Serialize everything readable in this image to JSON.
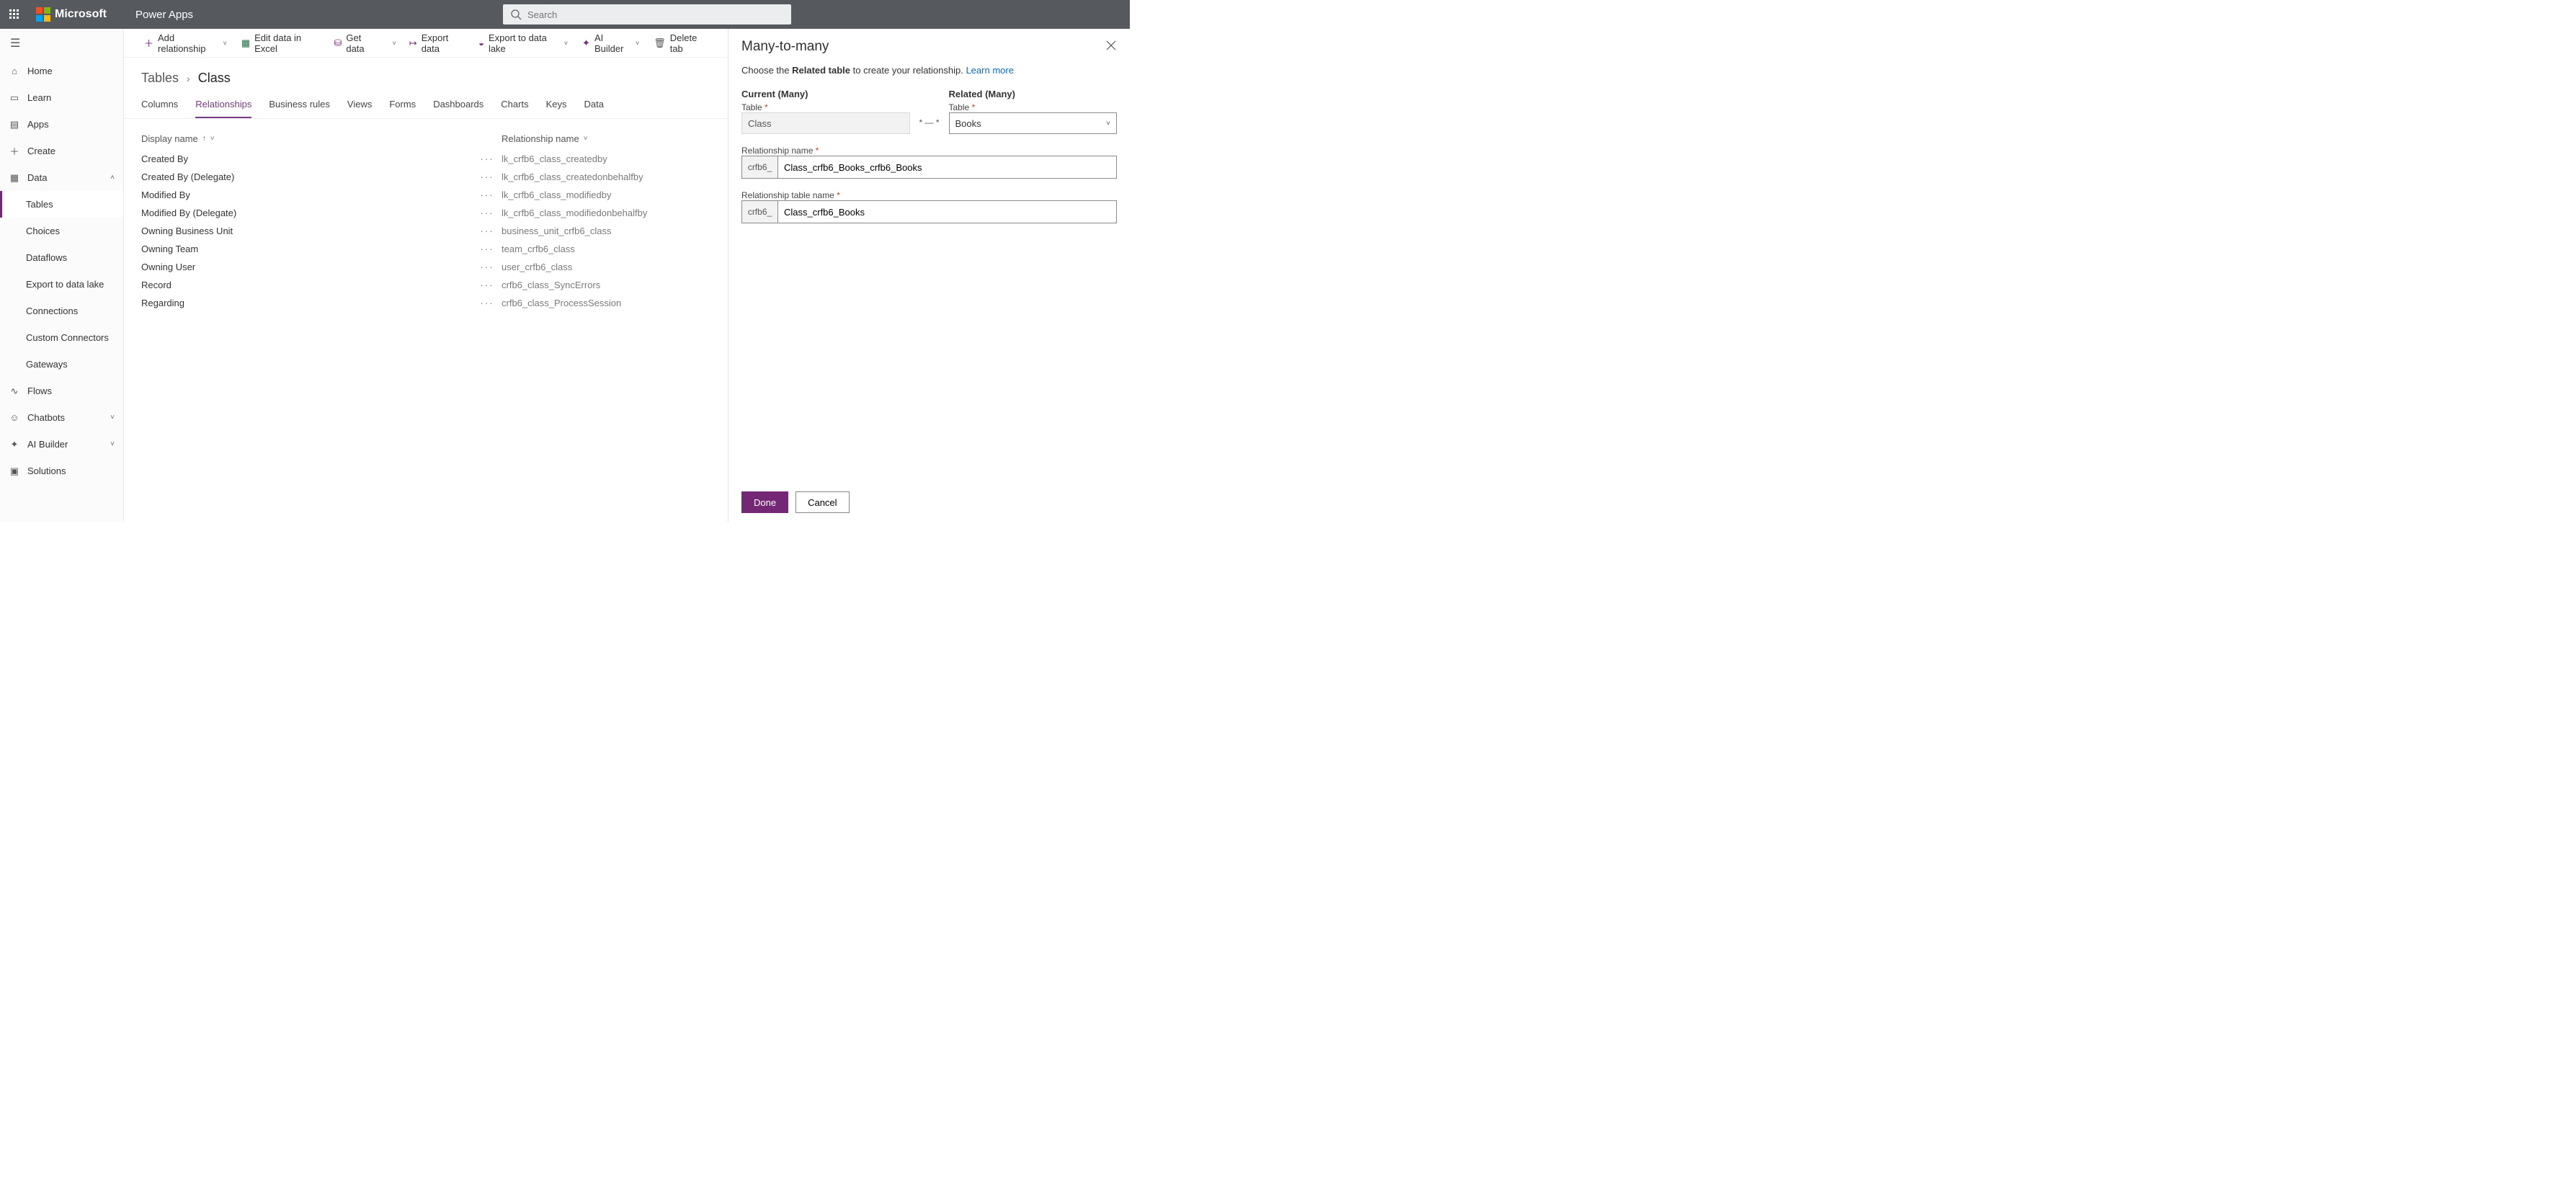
{
  "topbar": {
    "brand": "Microsoft",
    "app": "Power Apps",
    "search_placeholder": "Search"
  },
  "sidebar": {
    "home": "Home",
    "learn": "Learn",
    "apps": "Apps",
    "create": "Create",
    "data": "Data",
    "data_items": [
      "Tables",
      "Choices",
      "Dataflows",
      "Export to data lake",
      "Connections",
      "Custom Connectors",
      "Gateways"
    ],
    "flows": "Flows",
    "chatbots": "Chatbots",
    "aibuilder": "AI Builder",
    "solutions": "Solutions"
  },
  "cmdbar": {
    "add": "Add relationship",
    "excel": "Edit data in Excel",
    "getdata": "Get data",
    "export": "Export data",
    "lake": "Export to data lake",
    "ai": "AI Builder",
    "delete": "Delete tab"
  },
  "breadcrumb": {
    "root": "Tables",
    "current": "Class"
  },
  "tabs": [
    "Columns",
    "Relationships",
    "Business rules",
    "Views",
    "Forms",
    "Dashboards",
    "Charts",
    "Keys",
    "Data"
  ],
  "active_tab": "Relationships",
  "grid": {
    "col1": "Display name",
    "col2": "Relationship name",
    "rows": [
      {
        "d": "Created By",
        "r": "lk_crfb6_class_createdby"
      },
      {
        "d": "Created By (Delegate)",
        "r": "lk_crfb6_class_createdonbehalfby"
      },
      {
        "d": "Modified By",
        "r": "lk_crfb6_class_modifiedby"
      },
      {
        "d": "Modified By (Delegate)",
        "r": "lk_crfb6_class_modifiedonbehalfby"
      },
      {
        "d": "Owning Business Unit",
        "r": "business_unit_crfb6_class"
      },
      {
        "d": "Owning Team",
        "r": "team_crfb6_class"
      },
      {
        "d": "Owning User",
        "r": "user_crfb6_class"
      },
      {
        "d": "Record",
        "r": "crfb6_class_SyncErrors"
      },
      {
        "d": "Regarding",
        "r": "crfb6_class_ProcessSession"
      }
    ]
  },
  "panel": {
    "title": "Many-to-many",
    "hint_a": "Choose the ",
    "hint_b": "Related table",
    "hint_c": " to create your relationship. ",
    "learn": "Learn more",
    "current_heading": "Current (Many)",
    "related_heading": "Related (Many)",
    "table_label": "Table",
    "current_table": "Class",
    "related_table": "Books",
    "relname_label": "Relationship name",
    "reltablename_label": "Relationship table name",
    "prefix": "crfb6_",
    "relname_value": "Class_crfb6_Books_crfb6_Books",
    "reltablename_value": "Class_crfb6_Books",
    "done": "Done",
    "cancel": "Cancel"
  }
}
